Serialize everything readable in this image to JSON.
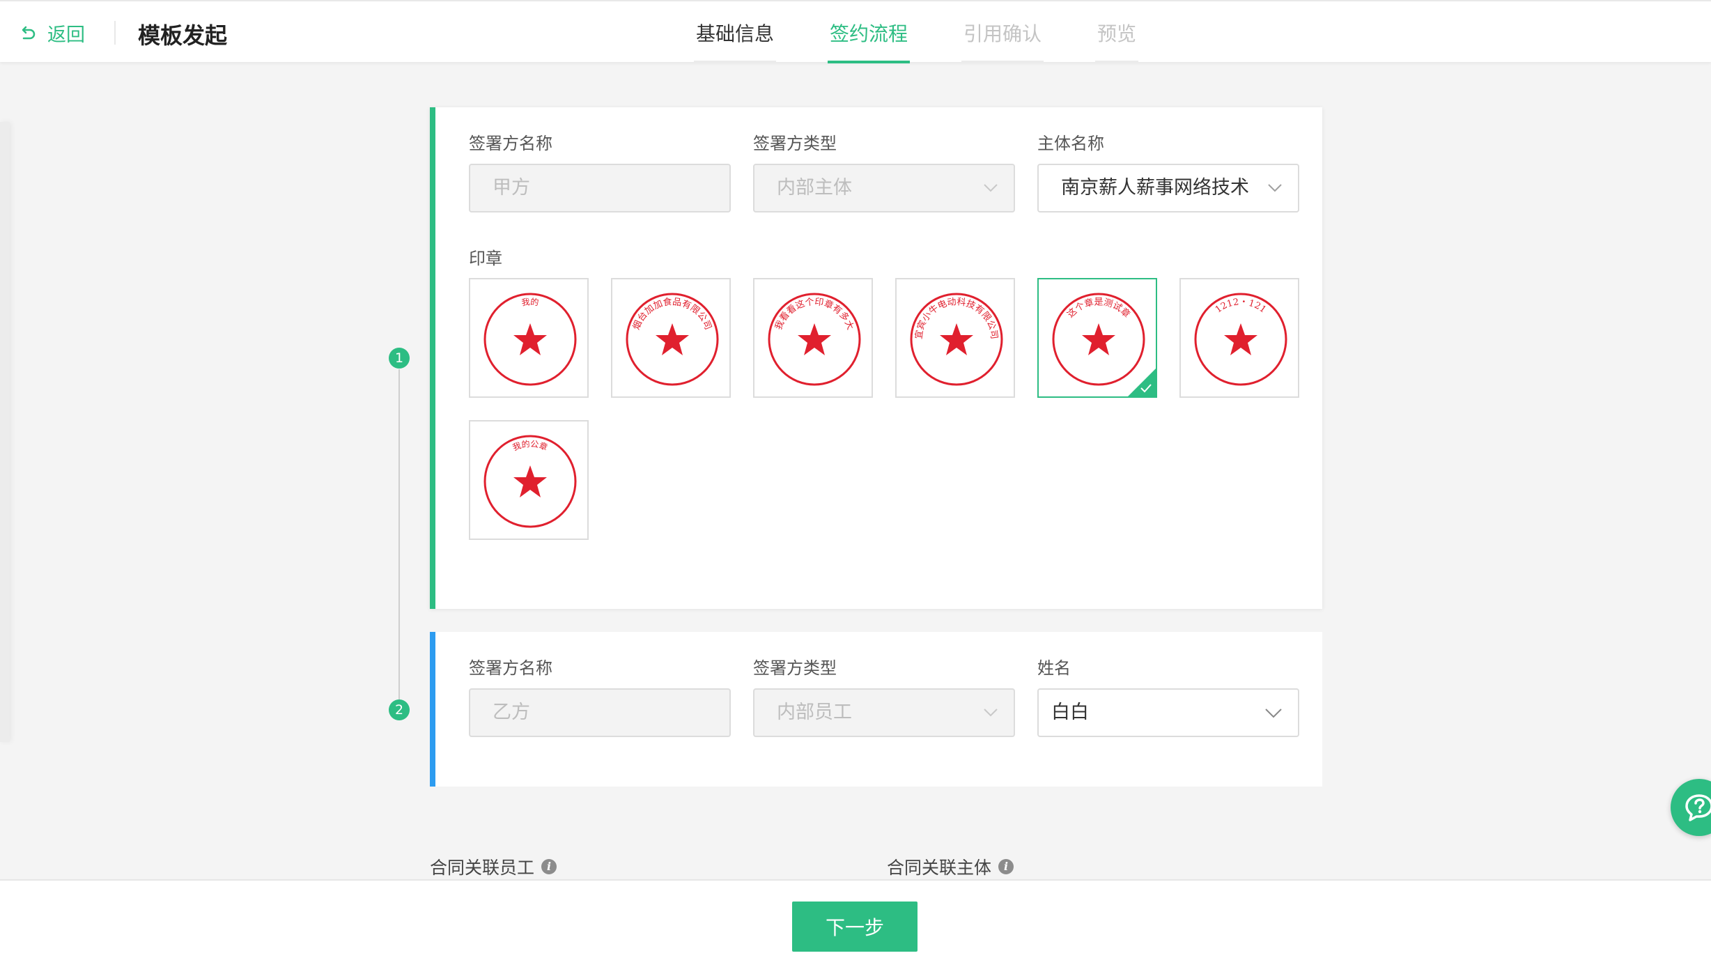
{
  "header": {
    "back_label": "返回",
    "title": "模板发起",
    "steps": [
      {
        "label": "基础信息",
        "state": "done"
      },
      {
        "label": "签约流程",
        "state": "active"
      },
      {
        "label": "引用确认",
        "state": "pending"
      },
      {
        "label": "预览",
        "state": "pending"
      }
    ]
  },
  "signers": [
    {
      "index": "1",
      "name_label": "签署方名称",
      "name_value": "甲方",
      "type_label": "签署方类型",
      "type_value": "内部主体",
      "subject_label": "主体名称",
      "subject_value": "南京薪人薪事网络技术",
      "seal_label": "印章",
      "seals": [
        {
          "text": "我的"
        },
        {
          "text": "烟台加加食品有限公司"
        },
        {
          "text": "我看看这个印章有多大"
        },
        {
          "text": "宜宾小牛电动科技有限公司"
        },
        {
          "text": "这个章是测试章",
          "selected": true
        },
        {
          "text": "1212・121"
        },
        {
          "text": "我的公章"
        }
      ]
    },
    {
      "index": "2",
      "name_label": "签署方名称",
      "name_value": "乙方",
      "type_label": "签署方类型",
      "type_value": "内部员工",
      "person_label": "姓名",
      "person_value": "白白"
    }
  ],
  "related": {
    "employee_label": "合同关联员工",
    "subject_label": "合同关联主体"
  },
  "footer": {
    "next_label": "下一步"
  },
  "colors": {
    "accent": "#2dbd83",
    "signer2": "#2d9cf0",
    "seal_red": "#e0202e"
  },
  "icons": [
    "undo-icon",
    "chevron-down-icon",
    "check-icon",
    "info-icon",
    "help-icon"
  ]
}
